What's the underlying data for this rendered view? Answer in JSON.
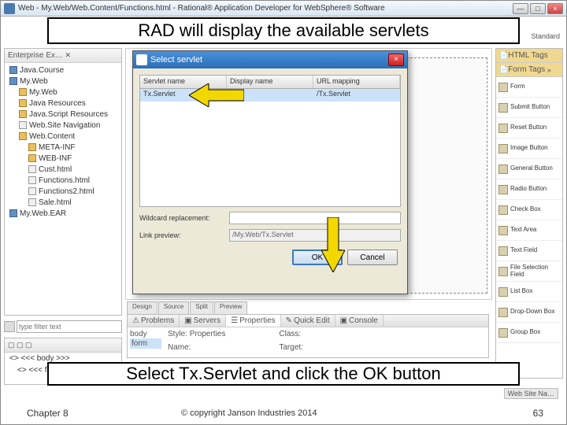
{
  "window": {
    "title": "Web - My.Web/Web.Content/Functions.html - Rational® Application Developer for WebSphere® Software"
  },
  "callouts": {
    "top": "RAD will display the available servlets",
    "bottom": "Select Tx.Servlet and click the OK button"
  },
  "footer": {
    "chapter": "Chapter 8",
    "copyright": "© copyright Janson Industries 2014",
    "page": "63"
  },
  "explorer": {
    "tab": "Enterprise Ex…",
    "items": [
      {
        "lvl": 0,
        "ico": "prj",
        "label": "Java.Course"
      },
      {
        "lvl": 0,
        "ico": "prj",
        "label": "My.Web"
      },
      {
        "lvl": 1,
        "ico": "fld",
        "label": "My.Web"
      },
      {
        "lvl": 1,
        "ico": "fld",
        "label": "Java Resources"
      },
      {
        "lvl": 1,
        "ico": "fld",
        "label": "Java.Script Resources"
      },
      {
        "lvl": 1,
        "ico": "fil",
        "label": "Web.Site Navigation"
      },
      {
        "lvl": 1,
        "ico": "fld",
        "label": "Web.Content"
      },
      {
        "lvl": 2,
        "ico": "fld",
        "label": "META-INF"
      },
      {
        "lvl": 2,
        "ico": "fld",
        "label": "WEB-INF"
      },
      {
        "lvl": 2,
        "ico": "fil",
        "label": "Cust.html"
      },
      {
        "lvl": 2,
        "ico": "fil",
        "label": "Functions.html"
      },
      {
        "lvl": 2,
        "ico": "fil",
        "label": "Functions2.html"
      },
      {
        "lvl": 2,
        "ico": "fil",
        "label": "Sale.html"
      },
      {
        "lvl": 0,
        "ico": "prj",
        "label": "My.Web.EAR"
      }
    ]
  },
  "typefilter": {
    "placeholder": "type filter text"
  },
  "outline": {
    "r1": "<<< body >>>",
    "r2": "<<< form >>>"
  },
  "dialog": {
    "title": "Select servlet",
    "cols": {
      "c1": "Servlet name",
      "c2": "Display name",
      "c3": "URL mapping"
    },
    "row": {
      "name": "Tx.Servlet",
      "disp": "",
      "url": "/Tx.Servlet"
    },
    "wildcard_lbl": "Wildcard replacement:",
    "wildcard_val": "",
    "preview_lbl": "Link preview:",
    "preview_val": "/My.Web/Tx.Servlet",
    "ok": "OK",
    "cancel": "Cancel"
  },
  "editor_tabs": {
    "t1": "Design",
    "t2": "Source",
    "t3": "Split",
    "t4": "Preview"
  },
  "bottom_tabs": {
    "t1": "Problems",
    "t2": "Servers",
    "t3": "Properties",
    "t4": "Quick Edit",
    "t5": "Console"
  },
  "bottom_body": {
    "lbl_body": "body",
    "lbl_form": "form",
    "style": "Style:",
    "props": "Properties",
    "class": "Class:",
    "name": "Name:",
    "target": "Target:"
  },
  "palette": {
    "hdr1": "HTML Tags",
    "hdr2": "Form Tags",
    "items": [
      "Form",
      "Submit Button",
      "Reset Button",
      "Image Button",
      "General Button",
      "Radio Button",
      "Check Box",
      "Text Area",
      "Text Field",
      "File Selection Field",
      "List Box",
      "Drop-Down Box",
      "Group Box"
    ]
  },
  "topright": {
    "std": "Standard"
  },
  "bottomright": {
    "lbl": "Web Site Na…"
  }
}
